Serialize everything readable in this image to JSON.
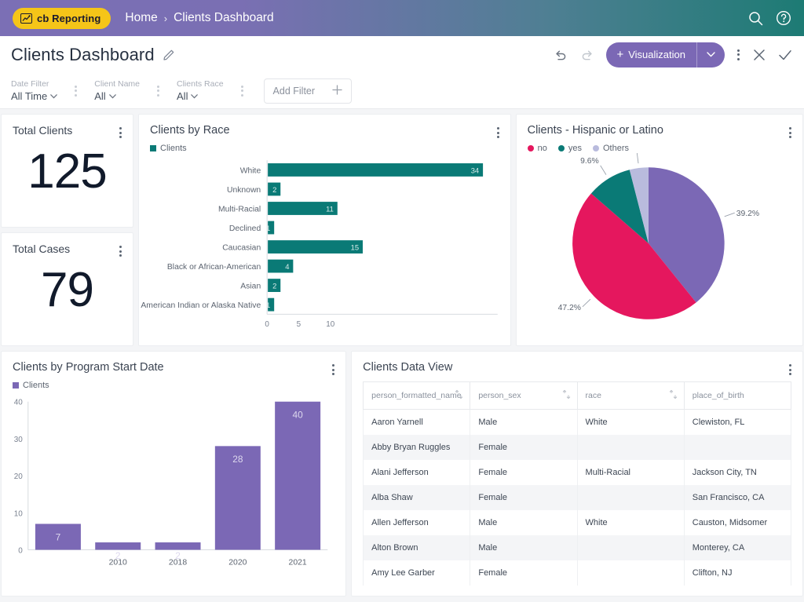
{
  "appbar": {
    "brand": "cb Reporting",
    "brand_icon": "chart-line-icon",
    "breadcrumb": {
      "home": "Home",
      "separator": "›",
      "current": "Clients Dashboard"
    },
    "search_icon": "search-icon",
    "help_icon": "help-circle-icon",
    "gradient_from": "#7b6fb5",
    "gradient_to": "#1d7b74",
    "brand_color": "#f5c518"
  },
  "titlebar": {
    "title": "Clients Dashboard",
    "edit_icon": "pencil-icon",
    "undo_icon": "undo-icon",
    "redo_icon": "redo-icon",
    "visualization_label": "Visualization",
    "visualization_plus": "+",
    "visualization_caret": "chevron-down-icon",
    "more_icon": "kebab-menu-icon",
    "close_icon": "close-icon",
    "confirm_icon": "check-icon",
    "accent_color": "#7b68b5"
  },
  "filters": {
    "items": [
      {
        "label": "Date Filter",
        "value": "All Time"
      },
      {
        "label": "Client Name",
        "value": "All"
      },
      {
        "label": "Clients Race",
        "value": "All"
      }
    ],
    "add_filter_label": "Add Filter",
    "add_filter_icon": "plus-icon"
  },
  "kpis": [
    {
      "title": "Total Clients",
      "value": "125"
    },
    {
      "title": "Total Cases",
      "value": "79"
    }
  ],
  "chart_data": [
    {
      "type": "bar",
      "orientation": "horizontal",
      "title": "Clients by Race",
      "legend": [
        "Clients"
      ],
      "legend_position": "top-left",
      "series_color": "#0a7a76",
      "categories": [
        "White",
        "Unknown",
        "Multi-Racial",
        "Declined",
        "Caucasian",
        "Black or African-American",
        "Asian",
        "American Indian or Alaska Native"
      ],
      "values": [
        34,
        2,
        11,
        1,
        15,
        4,
        2,
        1
      ],
      "xlabel": "",
      "ylabel": "",
      "xticks": [
        0,
        5,
        10
      ],
      "xlim": [
        0,
        36
      ],
      "grid": false,
      "data_labels": true
    },
    {
      "type": "pie",
      "title": "Clients - Hispanic or Latino",
      "legend": [
        "no",
        "yes",
        "Others"
      ],
      "legend_colors": [
        "#e5175e",
        "#0a7a76",
        "#b9bbdd"
      ],
      "legend_position": "top-left",
      "slices": [
        {
          "label": "",
          "value": 39.2,
          "display": "39.2%",
          "color": "#7b68b5"
        },
        {
          "label": "no",
          "value": 47.2,
          "display": "47.2%",
          "color": "#e5175e"
        },
        {
          "label": "yes",
          "value": 9.6,
          "display": "9.6%",
          "color": "#0a7a76"
        },
        {
          "label": "Others",
          "value": 4.0,
          "display": "Others",
          "color": "#b9bbdd"
        }
      ]
    },
    {
      "type": "bar",
      "orientation": "vertical",
      "title": "Clients by Program Start Date",
      "legend": [
        "Clients"
      ],
      "legend_position": "top-left",
      "series_color": "#7b68b5",
      "categories": [
        "",
        "2010",
        "2018",
        "2020",
        "2021"
      ],
      "values": [
        7,
        2,
        2,
        28,
        40
      ],
      "xlabel": "",
      "ylabel": "",
      "yticks": [
        0,
        10,
        20,
        30,
        40
      ],
      "ylim": [
        0,
        40
      ],
      "grid": false,
      "data_labels": true
    }
  ],
  "data_view": {
    "title": "Clients Data View",
    "sort_icon": "sort-icon",
    "columns": [
      "person_formatted_name",
      "person_sex",
      "race",
      "place_of_birth"
    ],
    "rows": [
      [
        "Aaron Yarnell",
        "Male",
        "White",
        "Clewiston, FL"
      ],
      [
        "Abby Bryan Ruggles",
        "Female",
        "",
        ""
      ],
      [
        "Alani Jefferson",
        "Female",
        "Multi-Racial",
        "Jackson City, TN"
      ],
      [
        "Alba Shaw",
        "Female",
        "",
        "San Francisco, CA"
      ],
      [
        "Allen Jefferson",
        "Male",
        "White",
        "Causton, Midsomer"
      ],
      [
        "Alton Brown",
        "Male",
        "",
        "Monterey, CA"
      ],
      [
        "Amy Lee Garber",
        "Female",
        "",
        "Clifton, NJ"
      ]
    ]
  }
}
